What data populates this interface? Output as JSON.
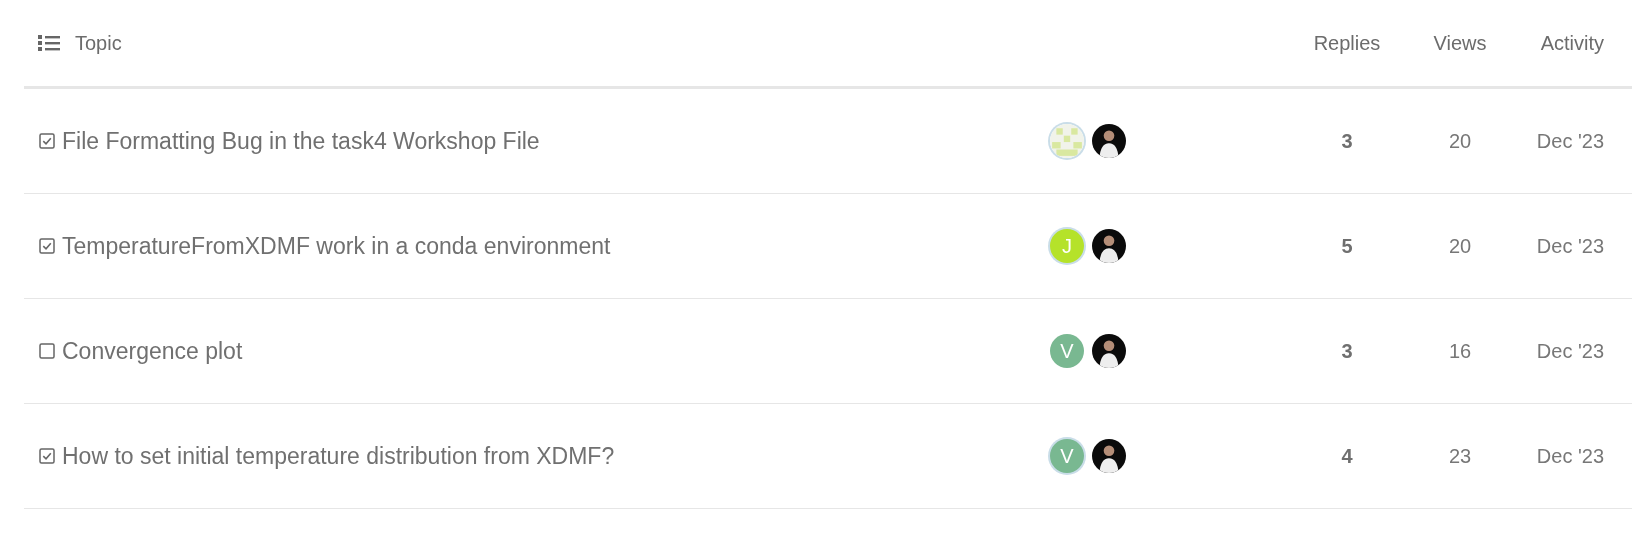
{
  "header": {
    "topic": "Topic",
    "replies": "Replies",
    "views": "Views",
    "activity": "Activity"
  },
  "topics": [
    {
      "title": "File Formatting Bug in the task4 Workshop File",
      "solved": true,
      "posters": [
        {
          "kind": "identicon",
          "highlighted": true
        },
        {
          "kind": "photo",
          "highlighted": false
        }
      ],
      "replies": "3",
      "views": "20",
      "activity": "Dec '23"
    },
    {
      "title": "TemperatureFromXDMF work in a conda environment",
      "solved": true,
      "posters": [
        {
          "kind": "letter",
          "letter": "J",
          "color": "#b5e22a",
          "highlighted": true
        },
        {
          "kind": "photo",
          "highlighted": false
        }
      ],
      "replies": "5",
      "views": "20",
      "activity": "Dec '23"
    },
    {
      "title": "Convergence plot",
      "solved": false,
      "posters": [
        {
          "kind": "letter",
          "letter": "V",
          "color": "#79b891",
          "highlighted": false
        },
        {
          "kind": "photo",
          "highlighted": false
        }
      ],
      "replies": "3",
      "views": "16",
      "activity": "Dec '23"
    },
    {
      "title": "How to set initial temperature distribution from XDMF?",
      "solved": true,
      "posters": [
        {
          "kind": "letter",
          "letter": "V",
          "color": "#79b891",
          "highlighted": true
        },
        {
          "kind": "photo",
          "highlighted": false
        }
      ],
      "replies": "4",
      "views": "23",
      "activity": "Dec '23"
    }
  ]
}
